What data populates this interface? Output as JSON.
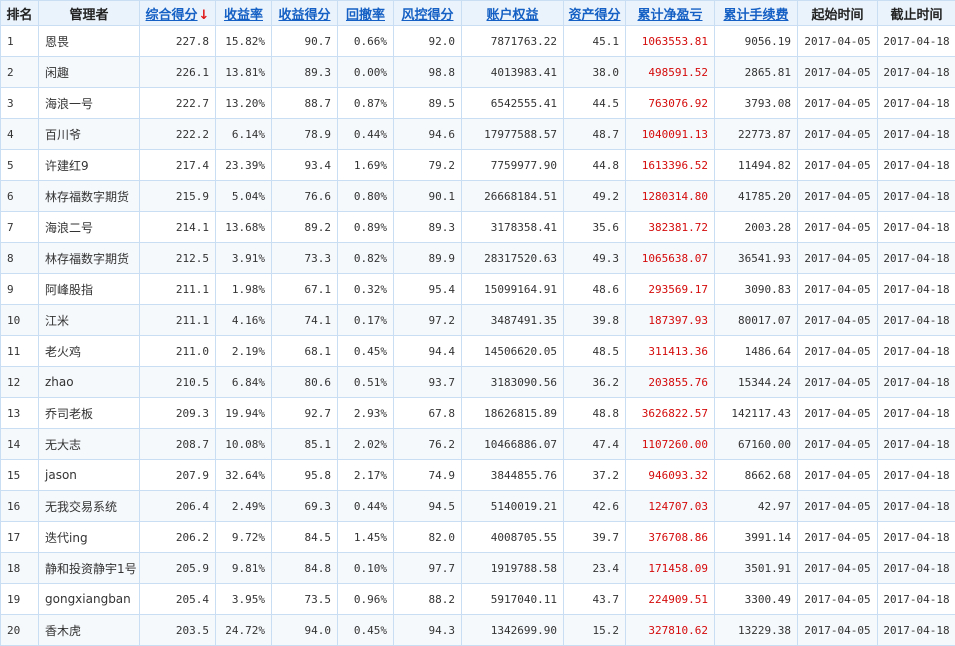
{
  "headers": {
    "rank": "排名",
    "manager": "管理者",
    "composite_score": "综合得分",
    "return_rate": "收益率",
    "return_score": "收益得分",
    "drawdown": "回撤率",
    "risk_score": "风控得分",
    "equity": "账户权益",
    "asset_score": "资产得分",
    "net_pnl": "累计净盈亏",
    "fees": "累计手续费",
    "start_date": "起始时间",
    "end_date": "截止时间"
  },
  "sort_arrow": "↓",
  "colors": {
    "header_bg": "#eaf3fb",
    "link": "#1560c4",
    "pnl_red": "#d40b0b",
    "border": "#c9def2"
  },
  "rows": [
    {
      "rank": "1",
      "manager": "恩畏",
      "composite": "227.8",
      "return_rate": "15.82%",
      "return_score": "90.7",
      "drawdown": "0.66%",
      "risk": "92.0",
      "equity": "7871763.22",
      "asset": "45.1",
      "pnl": "1063553.81",
      "fees": "9056.19",
      "start": "2017-04-05",
      "end": "2017-04-18"
    },
    {
      "rank": "2",
      "manager": "闲趣",
      "composite": "226.1",
      "return_rate": "13.81%",
      "return_score": "89.3",
      "drawdown": "0.00%",
      "risk": "98.8",
      "equity": "4013983.41",
      "asset": "38.0",
      "pnl": "498591.52",
      "fees": "2865.81",
      "start": "2017-04-05",
      "end": "2017-04-18"
    },
    {
      "rank": "3",
      "manager": "海浪一号",
      "composite": "222.7",
      "return_rate": "13.20%",
      "return_score": "88.7",
      "drawdown": "0.87%",
      "risk": "89.5",
      "equity": "6542555.41",
      "asset": "44.5",
      "pnl": "763076.92",
      "fees": "3793.08",
      "start": "2017-04-05",
      "end": "2017-04-18"
    },
    {
      "rank": "4",
      "manager": "百川爷",
      "composite": "222.2",
      "return_rate": "6.14%",
      "return_score": "78.9",
      "drawdown": "0.44%",
      "risk": "94.6",
      "equity": "17977588.57",
      "asset": "48.7",
      "pnl": "1040091.13",
      "fees": "22773.87",
      "start": "2017-04-05",
      "end": "2017-04-18"
    },
    {
      "rank": "5",
      "manager": "许建红9",
      "composite": "217.4",
      "return_rate": "23.39%",
      "return_score": "93.4",
      "drawdown": "1.69%",
      "risk": "79.2",
      "equity": "7759977.90",
      "asset": "44.8",
      "pnl": "1613396.52",
      "fees": "11494.82",
      "start": "2017-04-05",
      "end": "2017-04-18"
    },
    {
      "rank": "6",
      "manager": "林存福数字期货",
      "composite": "215.9",
      "return_rate": "5.04%",
      "return_score": "76.6",
      "drawdown": "0.80%",
      "risk": "90.1",
      "equity": "26668184.51",
      "asset": "49.2",
      "pnl": "1280314.80",
      "fees": "41785.20",
      "start": "2017-04-05",
      "end": "2017-04-18"
    },
    {
      "rank": "7",
      "manager": "海浪二号",
      "composite": "214.1",
      "return_rate": "13.68%",
      "return_score": "89.2",
      "drawdown": "0.89%",
      "risk": "89.3",
      "equity": "3178358.41",
      "asset": "35.6",
      "pnl": "382381.72",
      "fees": "2003.28",
      "start": "2017-04-05",
      "end": "2017-04-18"
    },
    {
      "rank": "8",
      "manager": "林存福数字期货",
      "composite": "212.5",
      "return_rate": "3.91%",
      "return_score": "73.3",
      "drawdown": "0.82%",
      "risk": "89.9",
      "equity": "28317520.63",
      "asset": "49.3",
      "pnl": "1065638.07",
      "fees": "36541.93",
      "start": "2017-04-05",
      "end": "2017-04-18"
    },
    {
      "rank": "9",
      "manager": "阿峰股指",
      "composite": "211.1",
      "return_rate": "1.98%",
      "return_score": "67.1",
      "drawdown": "0.32%",
      "risk": "95.4",
      "equity": "15099164.91",
      "asset": "48.6",
      "pnl": "293569.17",
      "fees": "3090.83",
      "start": "2017-04-05",
      "end": "2017-04-18"
    },
    {
      "rank": "10",
      "manager": "江米",
      "composite": "211.1",
      "return_rate": "4.16%",
      "return_score": "74.1",
      "drawdown": "0.17%",
      "risk": "97.2",
      "equity": "3487491.35",
      "asset": "39.8",
      "pnl": "187397.93",
      "fees": "80017.07",
      "start": "2017-04-05",
      "end": "2017-04-18"
    },
    {
      "rank": "11",
      "manager": "老火鸡",
      "composite": "211.0",
      "return_rate": "2.19%",
      "return_score": "68.1",
      "drawdown": "0.45%",
      "risk": "94.4",
      "equity": "14506620.05",
      "asset": "48.5",
      "pnl": "311413.36",
      "fees": "1486.64",
      "start": "2017-04-05",
      "end": "2017-04-18"
    },
    {
      "rank": "12",
      "manager": "zhao",
      "composite": "210.5",
      "return_rate": "6.84%",
      "return_score": "80.6",
      "drawdown": "0.51%",
      "risk": "93.7",
      "equity": "3183090.56",
      "asset": "36.2",
      "pnl": "203855.76",
      "fees": "15344.24",
      "start": "2017-04-05",
      "end": "2017-04-18"
    },
    {
      "rank": "13",
      "manager": "乔司老板",
      "composite": "209.3",
      "return_rate": "19.94%",
      "return_score": "92.7",
      "drawdown": "2.93%",
      "risk": "67.8",
      "equity": "18626815.89",
      "asset": "48.8",
      "pnl": "3626822.57",
      "fees": "142117.43",
      "start": "2017-04-05",
      "end": "2017-04-18"
    },
    {
      "rank": "14",
      "manager": "无大志",
      "composite": "208.7",
      "return_rate": "10.08%",
      "return_score": "85.1",
      "drawdown": "2.02%",
      "risk": "76.2",
      "equity": "10466886.07",
      "asset": "47.4",
      "pnl": "1107260.00",
      "fees": "67160.00",
      "start": "2017-04-05",
      "end": "2017-04-18"
    },
    {
      "rank": "15",
      "manager": "jason",
      "composite": "207.9",
      "return_rate": "32.64%",
      "return_score": "95.8",
      "drawdown": "2.17%",
      "risk": "74.9",
      "equity": "3844855.76",
      "asset": "37.2",
      "pnl": "946093.32",
      "fees": "8662.68",
      "start": "2017-04-05",
      "end": "2017-04-18"
    },
    {
      "rank": "16",
      "manager": "无我交易系统",
      "composite": "206.4",
      "return_rate": "2.49%",
      "return_score": "69.3",
      "drawdown": "0.44%",
      "risk": "94.5",
      "equity": "5140019.21",
      "asset": "42.6",
      "pnl": "124707.03",
      "fees": "42.97",
      "start": "2017-04-05",
      "end": "2017-04-18"
    },
    {
      "rank": "17",
      "manager": "迭代ing",
      "composite": "206.2",
      "return_rate": "9.72%",
      "return_score": "84.5",
      "drawdown": "1.45%",
      "risk": "82.0",
      "equity": "4008705.55",
      "asset": "39.7",
      "pnl": "376708.86",
      "fees": "3991.14",
      "start": "2017-04-05",
      "end": "2017-04-18"
    },
    {
      "rank": "18",
      "manager": "静和投资静宇1号",
      "composite": "205.9",
      "return_rate": "9.81%",
      "return_score": "84.8",
      "drawdown": "0.10%",
      "risk": "97.7",
      "equity": "1919788.58",
      "asset": "23.4",
      "pnl": "171458.09",
      "fees": "3501.91",
      "start": "2017-04-05",
      "end": "2017-04-18"
    },
    {
      "rank": "19",
      "manager": "gongxiangban",
      "composite": "205.4",
      "return_rate": "3.95%",
      "return_score": "73.5",
      "drawdown": "0.96%",
      "risk": "88.2",
      "equity": "5917040.11",
      "asset": "43.7",
      "pnl": "224909.51",
      "fees": "3300.49",
      "start": "2017-04-05",
      "end": "2017-04-18"
    },
    {
      "rank": "20",
      "manager": "香木虎",
      "composite": "203.5",
      "return_rate": "24.72%",
      "return_score": "94.0",
      "drawdown": "0.45%",
      "risk": "94.3",
      "equity": "1342699.90",
      "asset": "15.2",
      "pnl": "327810.62",
      "fees": "13229.38",
      "start": "2017-04-05",
      "end": "2017-04-18"
    }
  ]
}
